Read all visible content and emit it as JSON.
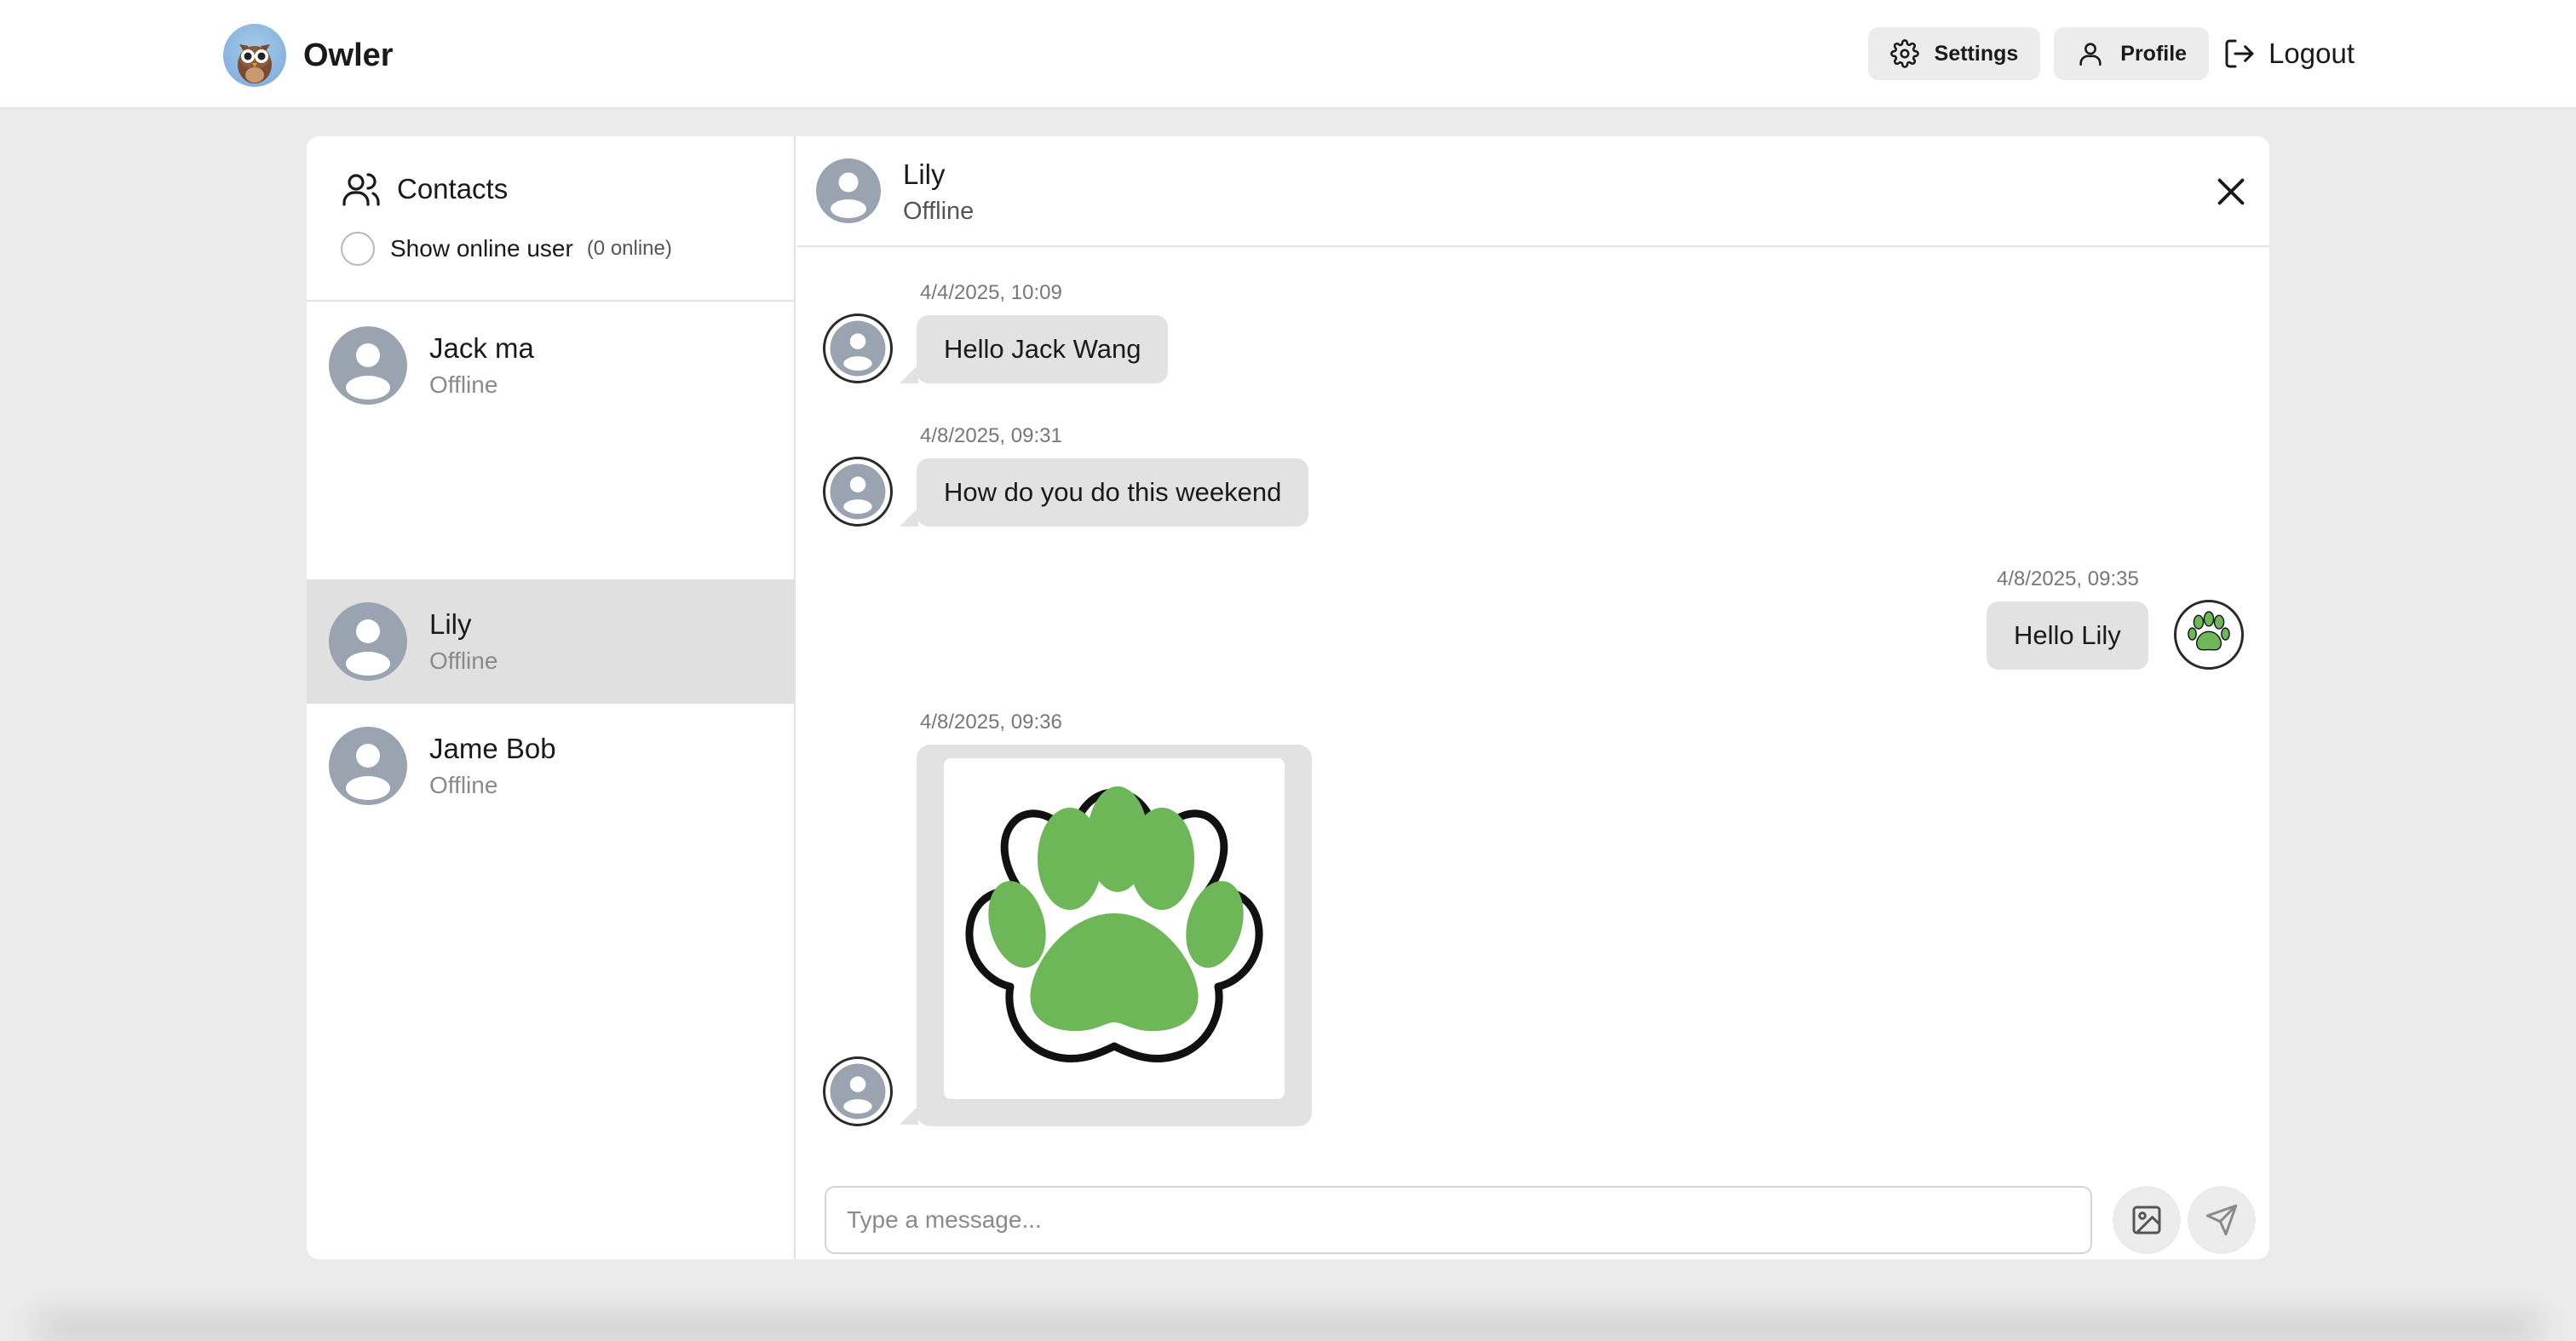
{
  "header": {
    "app_name": "Owler",
    "logo_icon": "owl-logo-icon",
    "settings_label": "Settings",
    "profile_label": "Profile",
    "logout_label": "Logout"
  },
  "sidebar": {
    "title": "Contacts",
    "show_online_label": "Show online user",
    "online_count": "(0 online)",
    "show_online_checked": false,
    "contacts": [
      {
        "name": "Jack ma",
        "status": "Offline",
        "active": false
      },
      {
        "name": "Lily",
        "status": "Offline",
        "active": true
      },
      {
        "name": "Jame Bob",
        "status": "Offline",
        "active": false
      }
    ]
  },
  "chat": {
    "header_name": "Lily",
    "header_status": "Offline",
    "messages": [
      {
        "timestamp": "4/4/2025, 10:09",
        "text": "Hello Jack Wang",
        "side": "left",
        "type": "text"
      },
      {
        "timestamp": "4/8/2025, 09:31",
        "text": "How do you do this weekend",
        "side": "left",
        "type": "text"
      },
      {
        "timestamp": "4/8/2025, 09:35",
        "text": "Hello Lily",
        "side": "right",
        "type": "text"
      },
      {
        "timestamp": "4/8/2025, 09:36",
        "side": "left",
        "type": "image",
        "image": "green-paw-print"
      }
    ],
    "composer_placeholder": "Type a message...",
    "composer_value": ""
  },
  "colors": {
    "page_bg": "#ebebeb",
    "bubble_bg": "#e2e2e2",
    "active_contact_bg": "#e0e0e0",
    "paw_green": "#6db758",
    "avatar_gray": "#9aa4b1"
  }
}
